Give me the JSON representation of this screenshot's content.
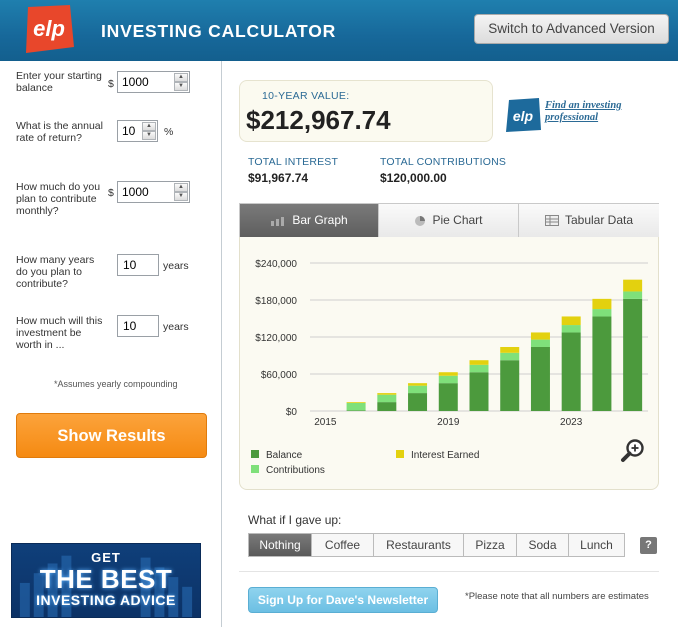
{
  "header": {
    "logo_text": "elp",
    "title": "INVESTING CALCULATOR",
    "switch_label": "Switch to Advanced Version"
  },
  "form": {
    "starting_balance": {
      "label": "Enter your starting balance",
      "prefix": "$",
      "value": "1000"
    },
    "rate": {
      "label": "What is the annual rate of return?",
      "value": "10",
      "suffix": "%"
    },
    "monthly": {
      "label": "How much do you plan to contribute monthly?",
      "prefix": "$",
      "value": "1000"
    },
    "contrib_years": {
      "label": "How many years do you plan to contribute?",
      "value": "10",
      "suffix": "years"
    },
    "worth_years": {
      "label": "How much will this investment be worth in ...",
      "value": "10",
      "suffix": "years"
    },
    "compounding_note": "*Assumes yearly compounding",
    "show_results_label": "Show Results"
  },
  "ad": {
    "line1": "GET",
    "line2": "THE BEST",
    "line3": "INVESTING ADVICE"
  },
  "results": {
    "value_label": "10-YEAR VALUE:",
    "value": "$212,967.74",
    "find_link": "Find an investing professional",
    "total_interest_label": "TOTAL INTEREST",
    "total_interest": "$91,967.74",
    "total_contrib_label": "TOTAL CONTRIBUTIONS",
    "total_contrib": "$120,000.00"
  },
  "tabs": [
    {
      "label": "Bar Graph",
      "active": true
    },
    {
      "label": "Pie Chart",
      "active": false
    },
    {
      "label": "Tabular Data",
      "active": false
    }
  ],
  "chart_data": {
    "type": "bar",
    "stacked": true,
    "categories": [
      "2015",
      "2016",
      "2017",
      "2018",
      "2019",
      "2020",
      "2021",
      "2022",
      "2023",
      "2024",
      "2025"
    ],
    "x_tick_labels": [
      "2015",
      "2019",
      "2023"
    ],
    "y_tick_labels": [
      "$240,000",
      "$180,000",
      "$120,000",
      "$60,000",
      "$0"
    ],
    "ylim": [
      0,
      240000
    ],
    "series": [
      {
        "name": "Balance",
        "color": "#4c9a3d",
        "values": [
          0,
          1100,
          14410,
          29051,
          45156,
          62872,
          82359,
          103795,
          127375,
          153312,
          181843
        ]
      },
      {
        "name": "Contributions",
        "color": "#7fe07a",
        "values": [
          0,
          12000,
          12000,
          12000,
          12000,
          12000,
          12000,
          12000,
          12000,
          12000,
          12000
        ]
      },
      {
        "name": "Interest Earned",
        "color": "#e3d10f",
        "values": [
          0,
          1310,
          2641,
          4105,
          5716,
          7487,
          9436,
          11580,
          13938,
          16531,
          19124
        ]
      }
    ],
    "grid": true
  },
  "whatif": {
    "label": "What if I gave up:",
    "options": [
      {
        "label": "Nothing",
        "active": true
      },
      {
        "label": "Coffee",
        "active": false
      },
      {
        "label": "Restaurants",
        "active": false
      },
      {
        "label": "Pizza",
        "active": false
      },
      {
        "label": "Soda",
        "active": false
      },
      {
        "label": "Lunch",
        "active": false
      }
    ],
    "help": "?"
  },
  "footer": {
    "signup_label": "Sign Up for Dave's Newsletter",
    "estimate_note": "*Please note that all numbers are estimates"
  },
  "colors": {
    "header_blue": "#17689a",
    "accent_orange": "#f58a12",
    "link_blue": "#2b6a95",
    "balance_green": "#4c9a3d",
    "contrib_green": "#7fe07a",
    "interest_yellow": "#e3d10f"
  }
}
